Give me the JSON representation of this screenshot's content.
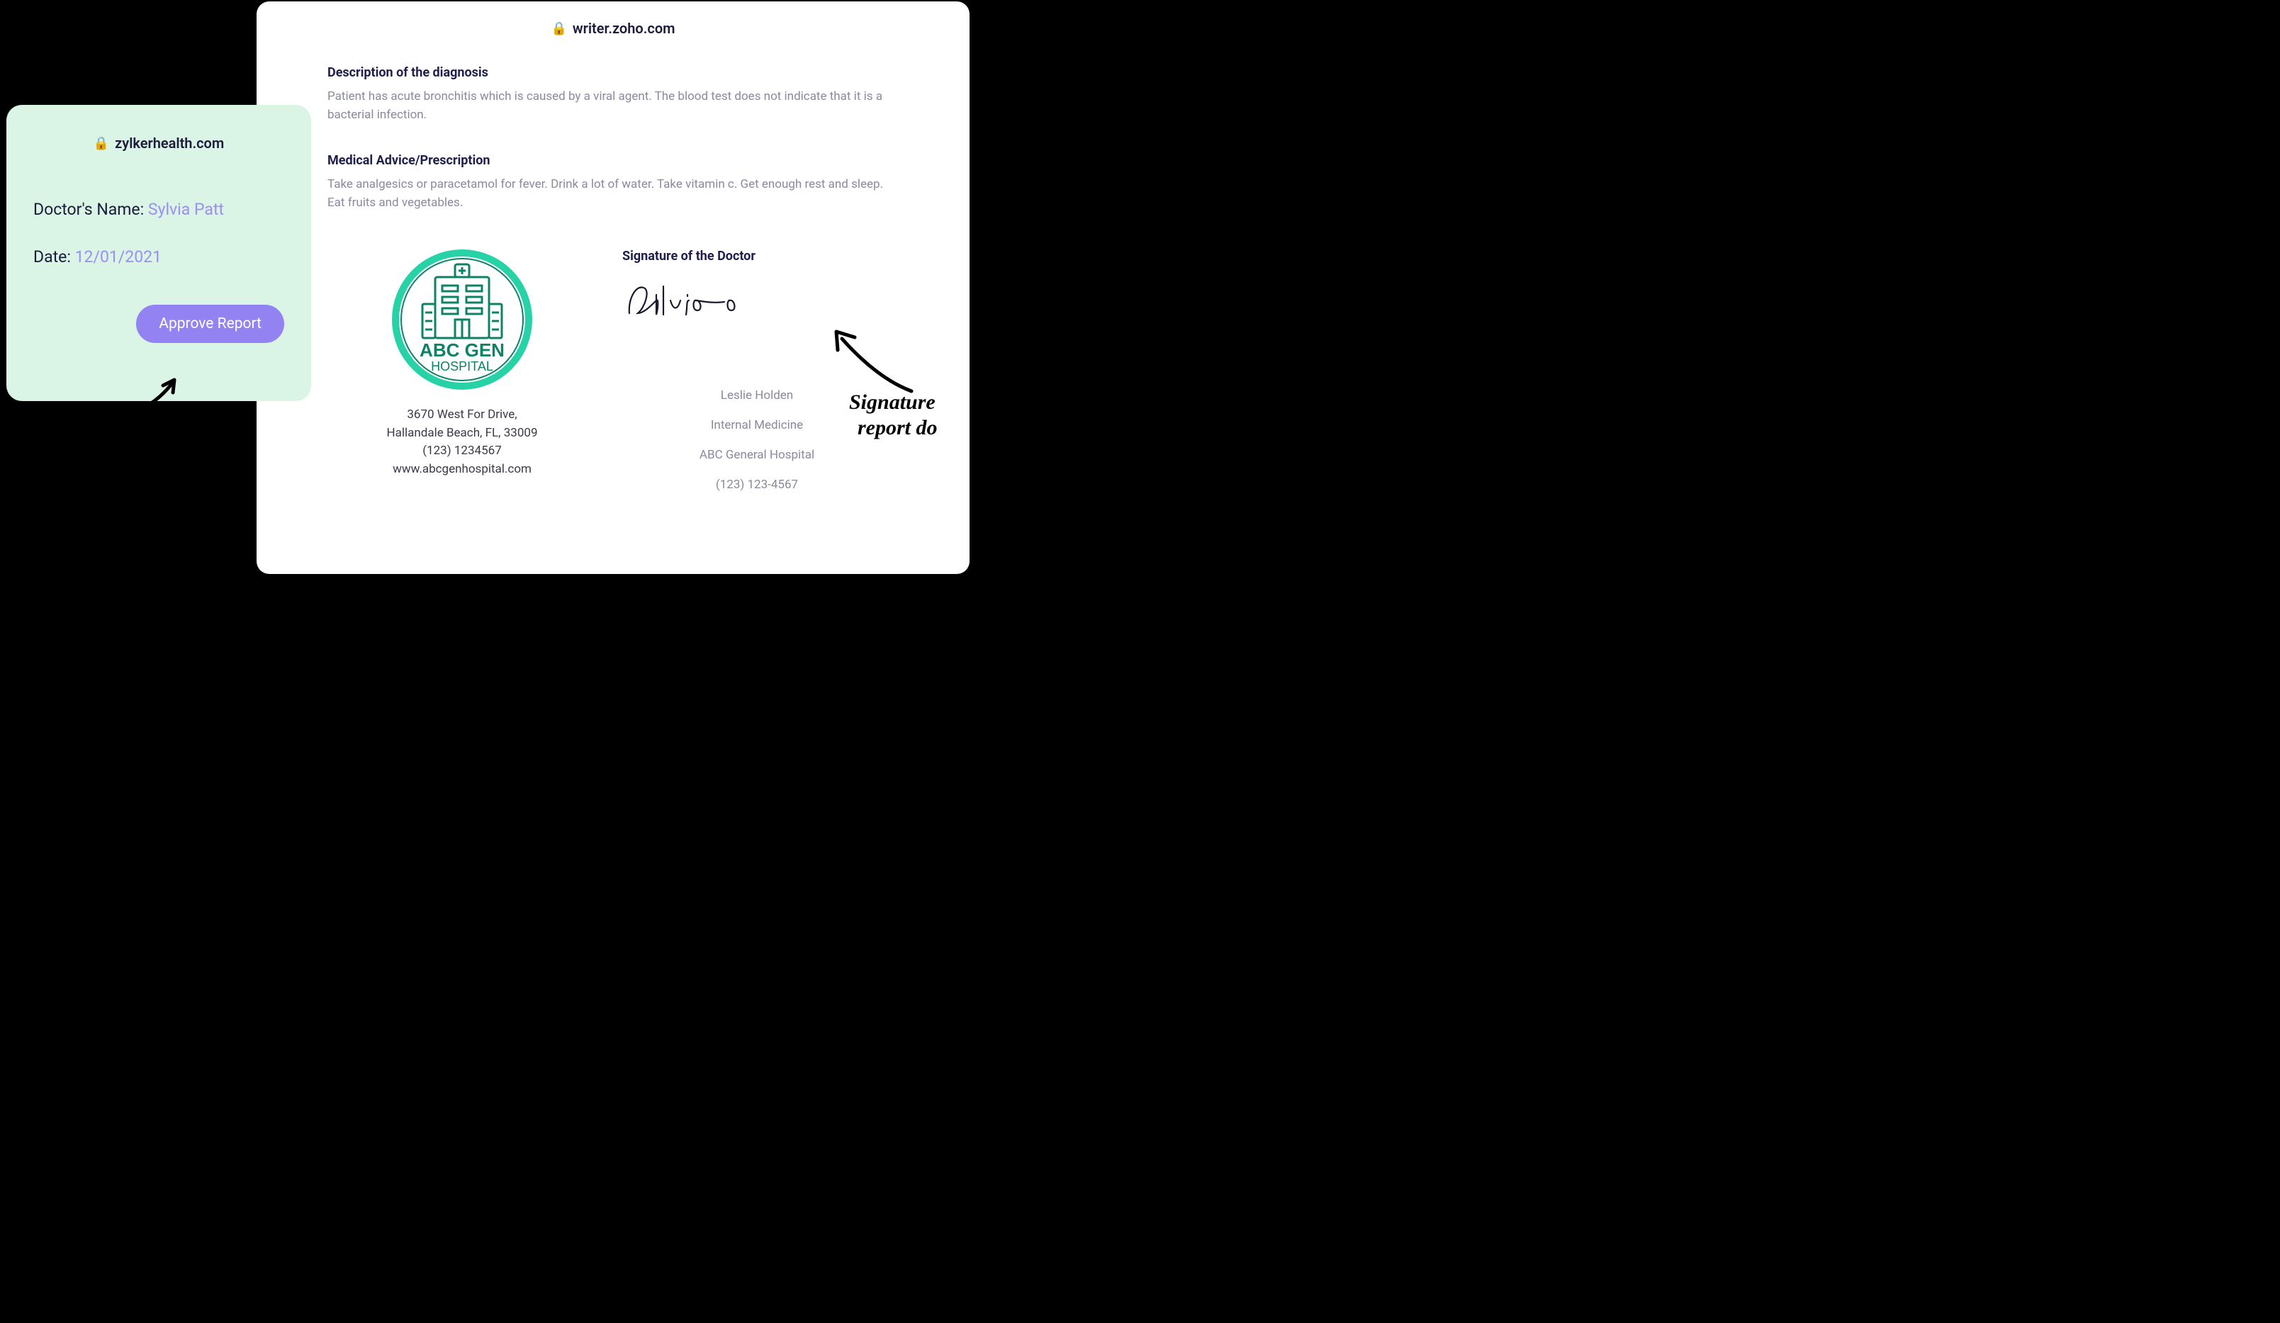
{
  "document": {
    "url": "writer.zoho.com",
    "diagnosis": {
      "title": "Description of the diagnosis",
      "body": "Patient has acute bronchitis which is caused by a viral agent. The blood test does not indicate that it is a bacterial infection."
    },
    "advice": {
      "title": "Medical Advice/Prescription",
      "body": "Take analgesics or paracetamol for fever. Drink a lot of water. Take vitamin c. Get enough rest and sleep. Eat fruits and vegetables."
    },
    "hospital": {
      "name_line1": "ABC GEN",
      "name_line2": "HOSPITAL",
      "address_line1": "3670 West For Drive,",
      "address_line2": "Hallandale Beach, FL, 33009",
      "phone": "(123) 1234567",
      "website": "www.abcgenhospital.com"
    },
    "signature": {
      "label": "Signature of the Doctor",
      "script": "Sylvia",
      "name": "Leslie Holden",
      "specialty": "Internal Medicine",
      "org": "ABC General Hospital",
      "phone": "(123) 123-4567"
    }
  },
  "approval": {
    "url": "zylkerhealth.com",
    "doctor_label": "Doctor's Name: ",
    "doctor_name": "Sylvia Patt",
    "date_label": "Date: ",
    "date_value": "12/01/2021",
    "button_label": "Approve Report"
  },
  "annotation": {
    "line1": "Signature ",
    "line2": "report do"
  }
}
